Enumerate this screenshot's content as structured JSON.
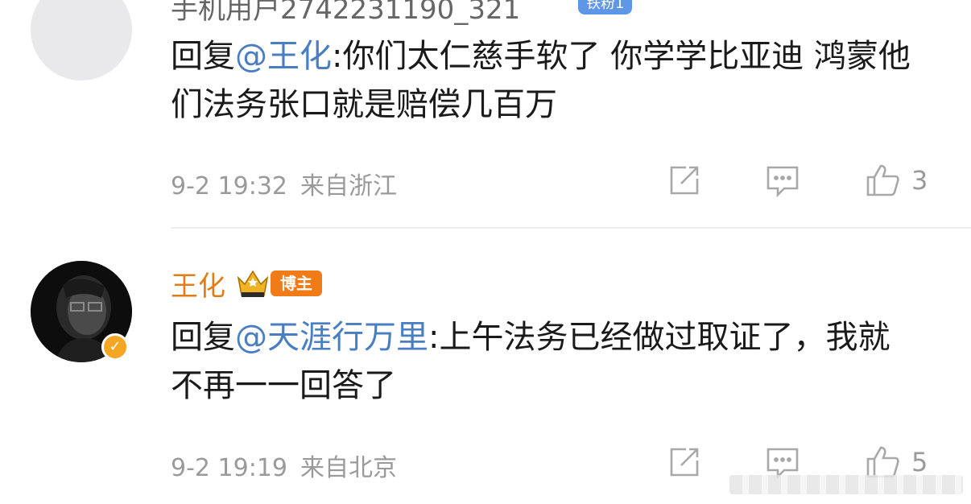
{
  "comments": [
    {
      "username": "手机用户2742231190_321",
      "badge": "铁粉1",
      "reply_prefix": "回复",
      "mention": "@王化",
      "content": ":你们太仁慈手软了 你学学比亚迪 鸿蒙他们法务张口就是赔偿几百万",
      "time": "9-2 19:32",
      "location": "来自浙江",
      "likes": "3"
    },
    {
      "username": "王化",
      "badge": "博主",
      "reply_prefix": "回复",
      "mention": "@天涯行万里",
      "content": ":上午法务已经做过取证了，我就不再一一回答了",
      "time": "9-2 19:19",
      "location": "来自北京",
      "likes": "5"
    }
  ],
  "icons": [
    "share-icon",
    "reply-icon",
    "like-icon",
    "crown-icon",
    "verified-icon"
  ],
  "colors": {
    "mention": "#4a7ec1",
    "blogger_name": "#e07d16",
    "blogger_tag": "#f07b17",
    "fan_tag": "#5f96e8",
    "meta_text": "#9a9a9a"
  }
}
